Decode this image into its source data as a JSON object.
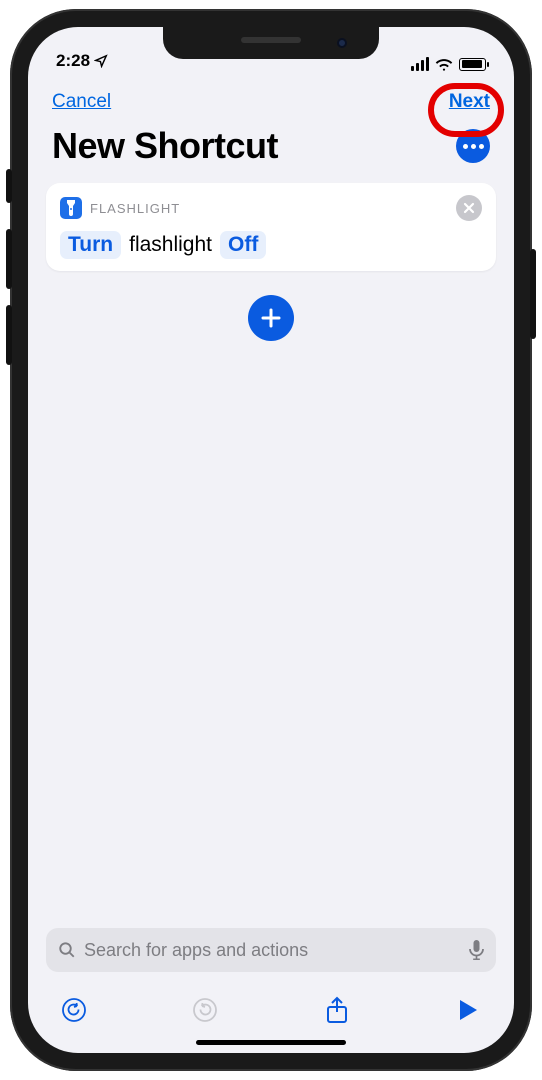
{
  "statusbar": {
    "time": "2:28"
  },
  "nav": {
    "cancel": "Cancel",
    "next": "Next"
  },
  "title": "New Shortcut",
  "action": {
    "app_label": "FLASHLIGHT",
    "param_action": "Turn",
    "target": "flashlight",
    "param_state": "Off"
  },
  "search": {
    "placeholder": "Search for apps and actions"
  },
  "colors": {
    "accent": "#0a5be0",
    "highlight_ring": "#e30000"
  }
}
